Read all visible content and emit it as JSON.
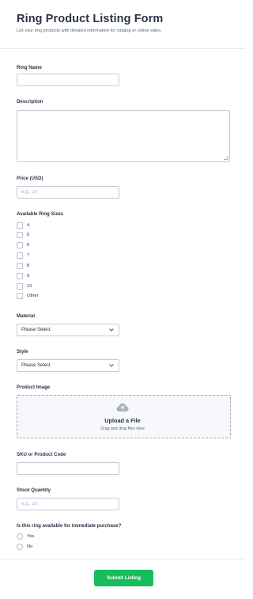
{
  "form": {
    "title": "Ring Product Listing Form",
    "subtitle": "List your ring products with detailed information for catalog or online sales."
  },
  "fields": {
    "ring_name": {
      "label": "Ring Name",
      "value": ""
    },
    "description": {
      "label": "Description",
      "value": ""
    },
    "price": {
      "label": "Price (USD)",
      "placeholder": "e.g., 23"
    },
    "sizes": {
      "label": "Available Ring Sizes",
      "options": [
        "4",
        "5",
        "6",
        "7",
        "8",
        "9",
        "10",
        "Other"
      ]
    },
    "material": {
      "label": "Material",
      "selected": "Please Select"
    },
    "style": {
      "label": "Style",
      "selected": "Please Select"
    },
    "image": {
      "label": "Product Image",
      "upload_title": "Upload a File",
      "upload_hint": "Drag and drop files here"
    },
    "sku": {
      "label": "SKU or Product Code",
      "value": ""
    },
    "stock": {
      "label": "Stock Quantity",
      "placeholder": "e.g., 23"
    },
    "availability": {
      "label": "Is this ring available for immediate purchase?",
      "options": [
        "Yes",
        "No"
      ]
    }
  },
  "actions": {
    "submit_label": "Submit Listing"
  },
  "colors": {
    "accent": "#18bd5b",
    "text": "#2c3345",
    "border": "#c3cad8"
  },
  "icons": {
    "upload": "cloud-upload-icon",
    "dropdown": "chevron-down-icon"
  }
}
